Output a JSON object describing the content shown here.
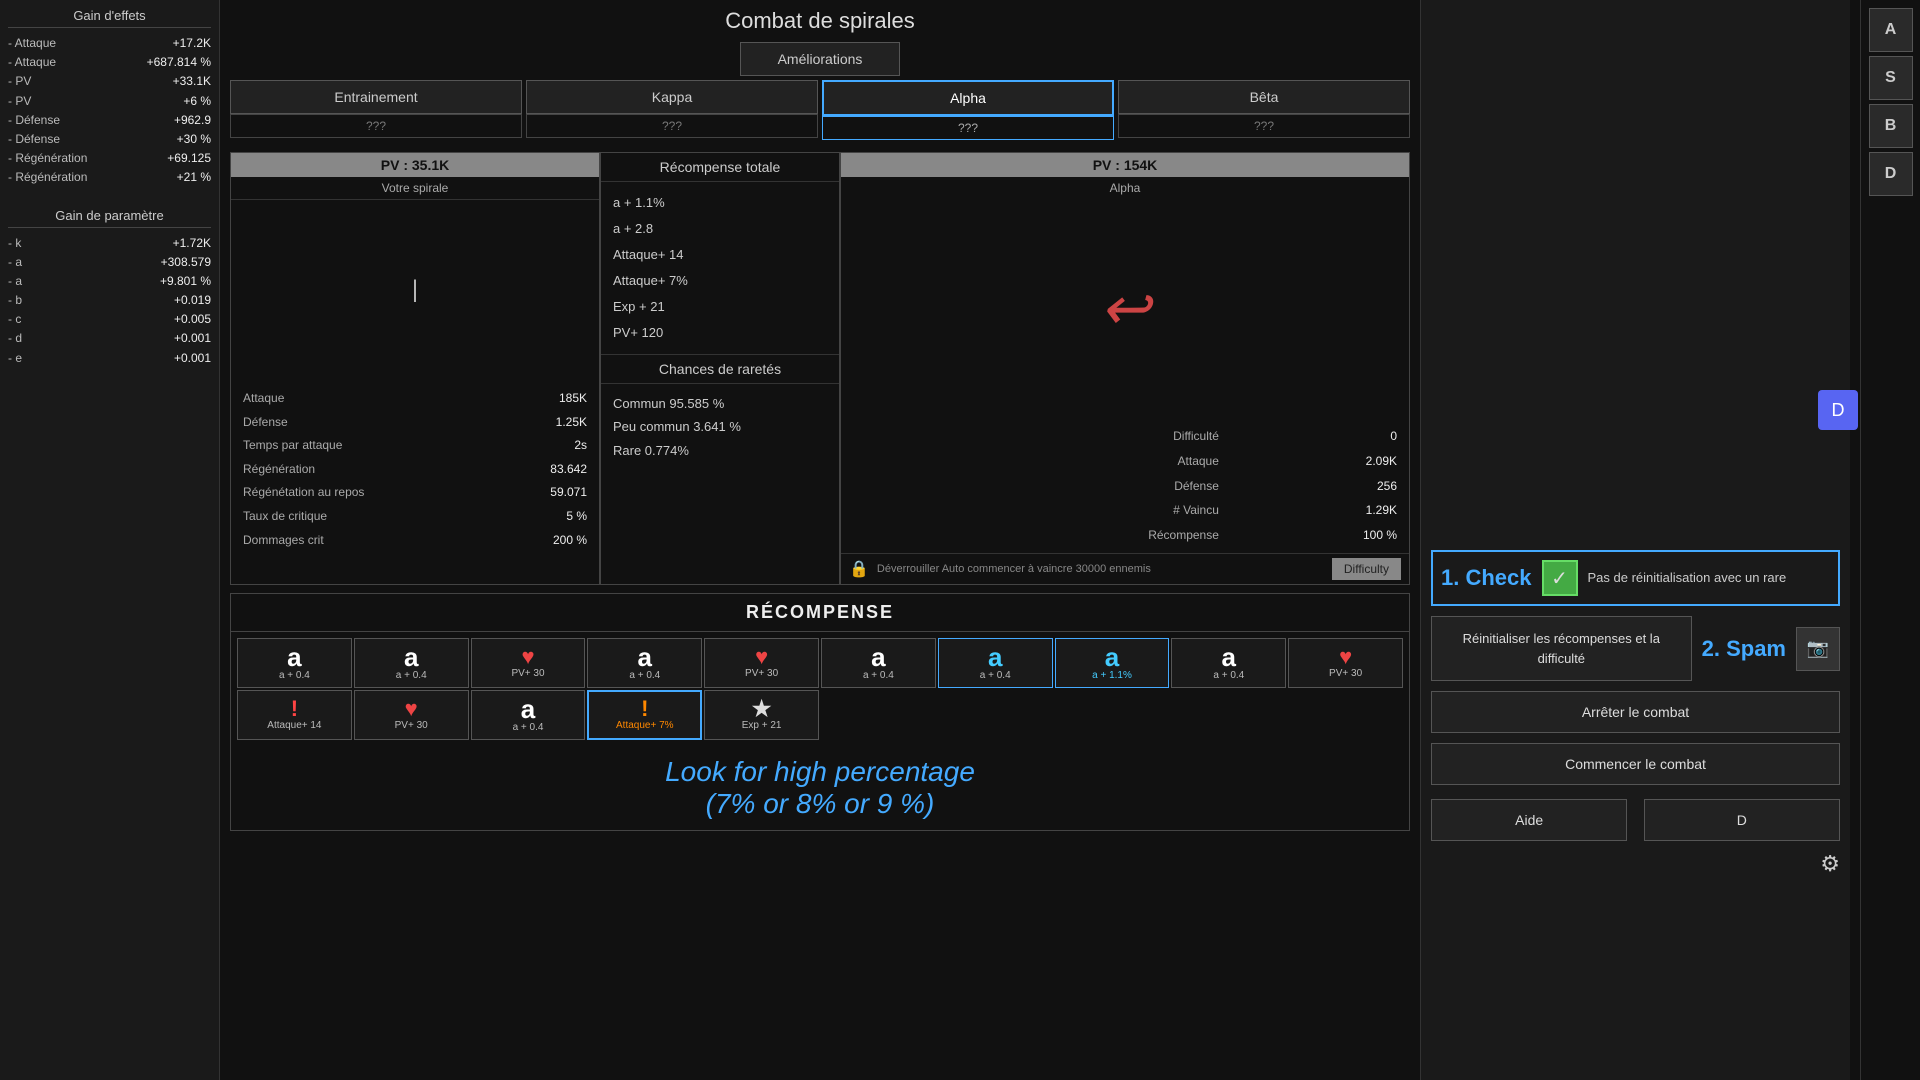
{
  "title": "Combat de spirales",
  "nav": {
    "ameliorations": "Améliorations",
    "tabs": [
      {
        "label": "Entrainement",
        "sub": "???",
        "active": false
      },
      {
        "label": "Kappa",
        "sub": "???",
        "active": false
      },
      {
        "label": "Alpha",
        "sub": "???",
        "active": true
      },
      {
        "label": "Bêta",
        "sub": "???",
        "active": false
      }
    ]
  },
  "player": {
    "hp_label": "PV : 35.1K",
    "arena_label": "Votre spirale",
    "stats": [
      {
        "name": "Attaque",
        "val": "185K"
      },
      {
        "name": "Défense",
        "val": "1.25K"
      },
      {
        "name": "Temps par attaque",
        "val": "2s"
      },
      {
        "name": "Régénération",
        "val": "83.642"
      },
      {
        "name": "Régénétation au repos",
        "val": "59.071"
      },
      {
        "name": "Taux de critique",
        "val": "5 %"
      },
      {
        "name": "Dommages crit",
        "val": "200 %"
      }
    ]
  },
  "reward_totale": {
    "header": "Récompense totale",
    "items": [
      "a + 1.1%",
      "a + 2.8",
      "Attaque+ 14",
      "Attaque+ 7%",
      "Exp + 21",
      "PV+ 120"
    ]
  },
  "chances": {
    "header": "Chances de raretés",
    "items": [
      {
        "name": "Commun",
        "val": "95.585 %"
      },
      {
        "name": "Peu commun",
        "val": "3.641 %"
      },
      {
        "name": "Rare",
        "val": "0.774%"
      }
    ]
  },
  "enemy": {
    "hp_label": "PV : 154K",
    "name": "Alpha",
    "stats": [
      {
        "name": "Difficulté",
        "val": "0"
      },
      {
        "name": "Attaque",
        "val": "2.09K"
      },
      {
        "name": "Défense",
        "val": "256"
      },
      {
        "name": "# Vaincu",
        "val": "1.29K"
      },
      {
        "name": "Récompense",
        "val": "100 %"
      }
    ],
    "unlock_text": "Déverrouiller Auto commencer à vaincre 30000 ennemis",
    "difficulty_btn": "Difficulty"
  },
  "reward_section": {
    "title": "RÉCOMPENSE",
    "grid": [
      {
        "icon": "a",
        "text": "a + 0.4",
        "type": "normal"
      },
      {
        "icon": "a",
        "text": "a + 0.4",
        "type": "normal"
      },
      {
        "icon": "♥",
        "text": "PV+ 30",
        "type": "heart"
      },
      {
        "icon": "a",
        "text": "a + 0.4",
        "type": "normal"
      },
      {
        "icon": "♥",
        "text": "PV+ 30",
        "type": "heart"
      },
      {
        "icon": "a",
        "text": "a + 0.4",
        "type": "normal"
      },
      {
        "icon": "a",
        "text": "a + 0.4",
        "type": "cyan"
      },
      {
        "icon": "a",
        "text": "a + 1.1%",
        "type": "cyan-text"
      },
      {
        "icon": "a",
        "text": "a + 0.4",
        "type": "normal"
      },
      {
        "icon": "♥",
        "text": "PV+ 30",
        "type": "heart"
      },
      {
        "icon": "!",
        "text": "Attaque+ 14",
        "type": "red-excl"
      },
      {
        "icon": "♥",
        "text": "PV+ 30",
        "type": "heart"
      },
      {
        "icon": "a",
        "text": "a + 0.4",
        "type": "normal"
      },
      {
        "icon": "!",
        "text": "Attaque+ 7%",
        "type": "orange-excl"
      },
      {
        "icon": "★",
        "text": "Exp + 21",
        "type": "star"
      }
    ],
    "look_for": "Look for high percentage\n(7% or 8% or 9 %)"
  },
  "right_panel": {
    "check_step": "1. Check",
    "check_label": "Pas de réinitialisation avec un rare",
    "spam_step": "2. Spam",
    "spam_btn_label": "Réinitialiser les récompenses et la difficulté",
    "stop_btn": "Arrêter le combat",
    "start_btn": "Commencer le combat"
  },
  "sidebar": {
    "gain_effets": "Gain d'effets",
    "effets": [
      {
        "name": "- Attaque",
        "val": "+17.2K"
      },
      {
        "name": "- Attaque",
        "val": "+687.814 %"
      },
      {
        "name": "- PV",
        "val": "+33.1K"
      },
      {
        "name": "- PV",
        "val": "+6 %"
      },
      {
        "name": "- Défense",
        "val": "+962.9"
      },
      {
        "name": "- Défense",
        "val": "+30 %"
      },
      {
        "name": "- Régénération",
        "val": "+69.125"
      },
      {
        "name": "- Régénération",
        "val": "+21 %"
      }
    ],
    "gain_parametre": "Gain de paramètre",
    "params": [
      {
        "name": "- k",
        "val": "+1.72K"
      },
      {
        "name": "- a",
        "val": "+308.579"
      },
      {
        "name": "- a",
        "val": "+9.801 %"
      },
      {
        "name": "- b",
        "val": "+0.019"
      },
      {
        "name": "- c",
        "val": "+0.005"
      },
      {
        "name": "- d",
        "val": "+0.001"
      },
      {
        "name": "- e",
        "val": "+0.001"
      }
    ]
  },
  "far_right_btns": [
    "A",
    "S",
    "B",
    "D"
  ],
  "bottom_right_btns": [
    "Aide",
    "D"
  ],
  "gear_icon": "⚙"
}
